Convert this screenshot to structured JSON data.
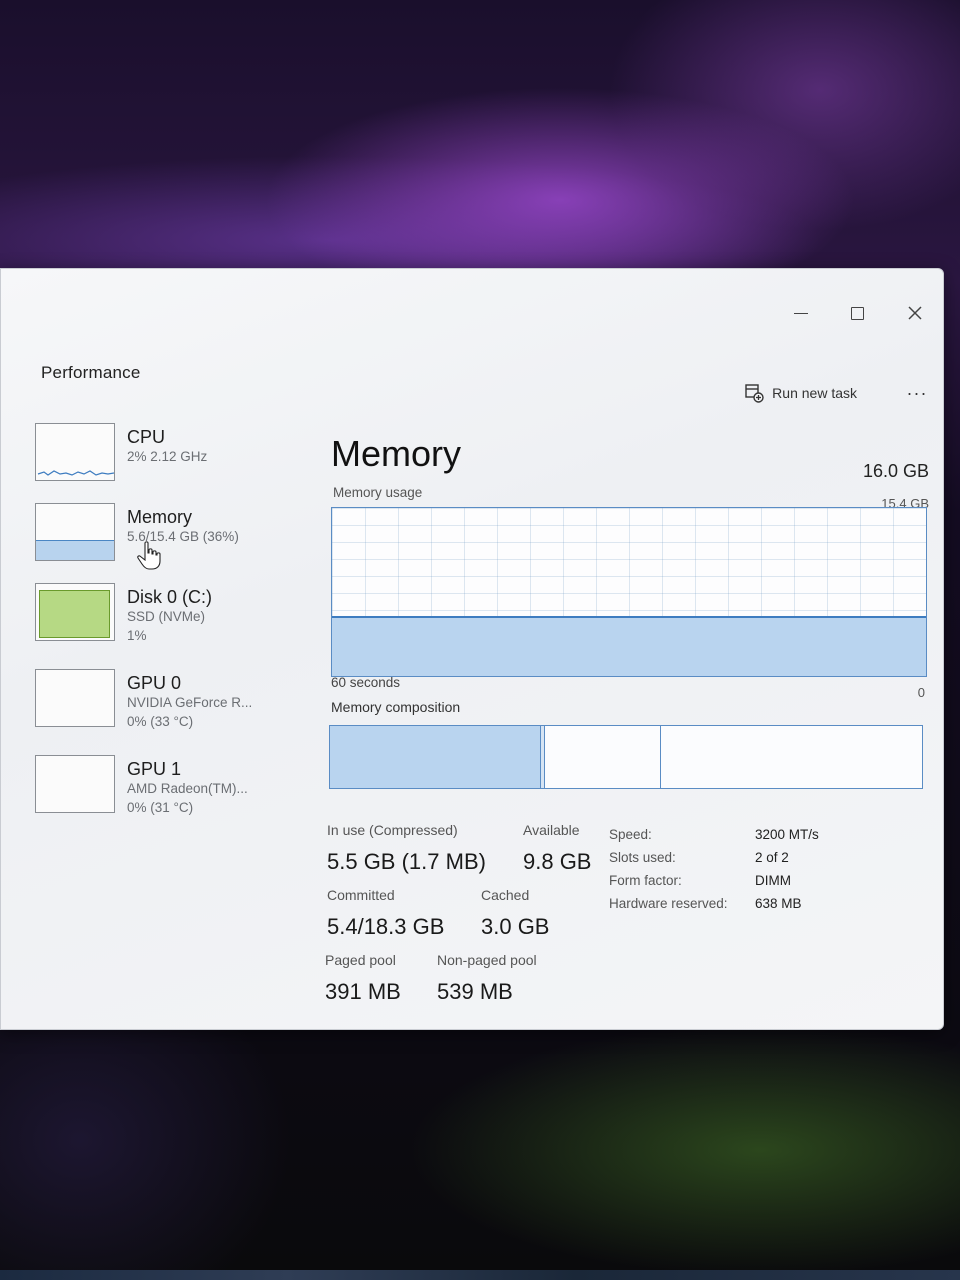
{
  "window": {
    "controls": {
      "minimize": "—",
      "maximize": "☐",
      "close": "✕"
    }
  },
  "header": {
    "page_title": "Performance",
    "run_new_task": "Run new task",
    "more": "···"
  },
  "resources": [
    {
      "name": "CPU",
      "line1": "2% 2.12 GHz",
      "line2": ""
    },
    {
      "name": "Memory",
      "line1": "5.6/15.4 GB (36%)",
      "line2": "",
      "selected": true
    },
    {
      "name": "Disk 0 (C:)",
      "line1": "SSD (NVMe)",
      "line2": "1%"
    },
    {
      "name": "GPU 0",
      "line1": "NVIDIA GeForce R...",
      "line2": "0% (33 °C)"
    },
    {
      "name": "GPU 1",
      "line1": "AMD Radeon(TM)...",
      "line2": "0% (31 °C)"
    }
  ],
  "memory": {
    "title": "Memory",
    "total": "16.0 GB",
    "usage_label": "Memory usage",
    "usage_max": "15.4 GB",
    "graph_time": "60 seconds",
    "graph_min": "0",
    "usage_fraction": 0.36,
    "composition_label": "Memory composition",
    "composition": {
      "in_use_gb": 5.5,
      "modified_gb": 0.1,
      "standby_gb": 3.0,
      "free_gb": 6.8
    }
  },
  "stats": {
    "in_use_label": "In use (Compressed)",
    "in_use_value": "5.5 GB (1.7 MB)",
    "available_label": "Available",
    "available_value": "9.8 GB",
    "committed_label": "Committed",
    "committed_value": "5.4/18.3 GB",
    "cached_label": "Cached",
    "cached_value": "3.0 GB",
    "paged_label": "Paged pool",
    "paged_value": "391 MB",
    "nonpaged_label": "Non-paged pool",
    "nonpaged_value": "539 MB"
  },
  "specs": [
    {
      "key": "Speed:",
      "value": "3200 MT/s"
    },
    {
      "key": "Slots used:",
      "value": "2 of 2"
    },
    {
      "key": "Form factor:",
      "value": "DIMM"
    },
    {
      "key": "Hardware reserved:",
      "value": "638 MB"
    }
  ],
  "icons": {
    "run_task": "run-task-icon",
    "close": "close-icon",
    "cursor": "hand-cursor-icon"
  },
  "colors": {
    "memory_accent": "#3d7cc0",
    "memory_fill": "#b9d4ef",
    "disk_fill": "#b6d984"
  }
}
